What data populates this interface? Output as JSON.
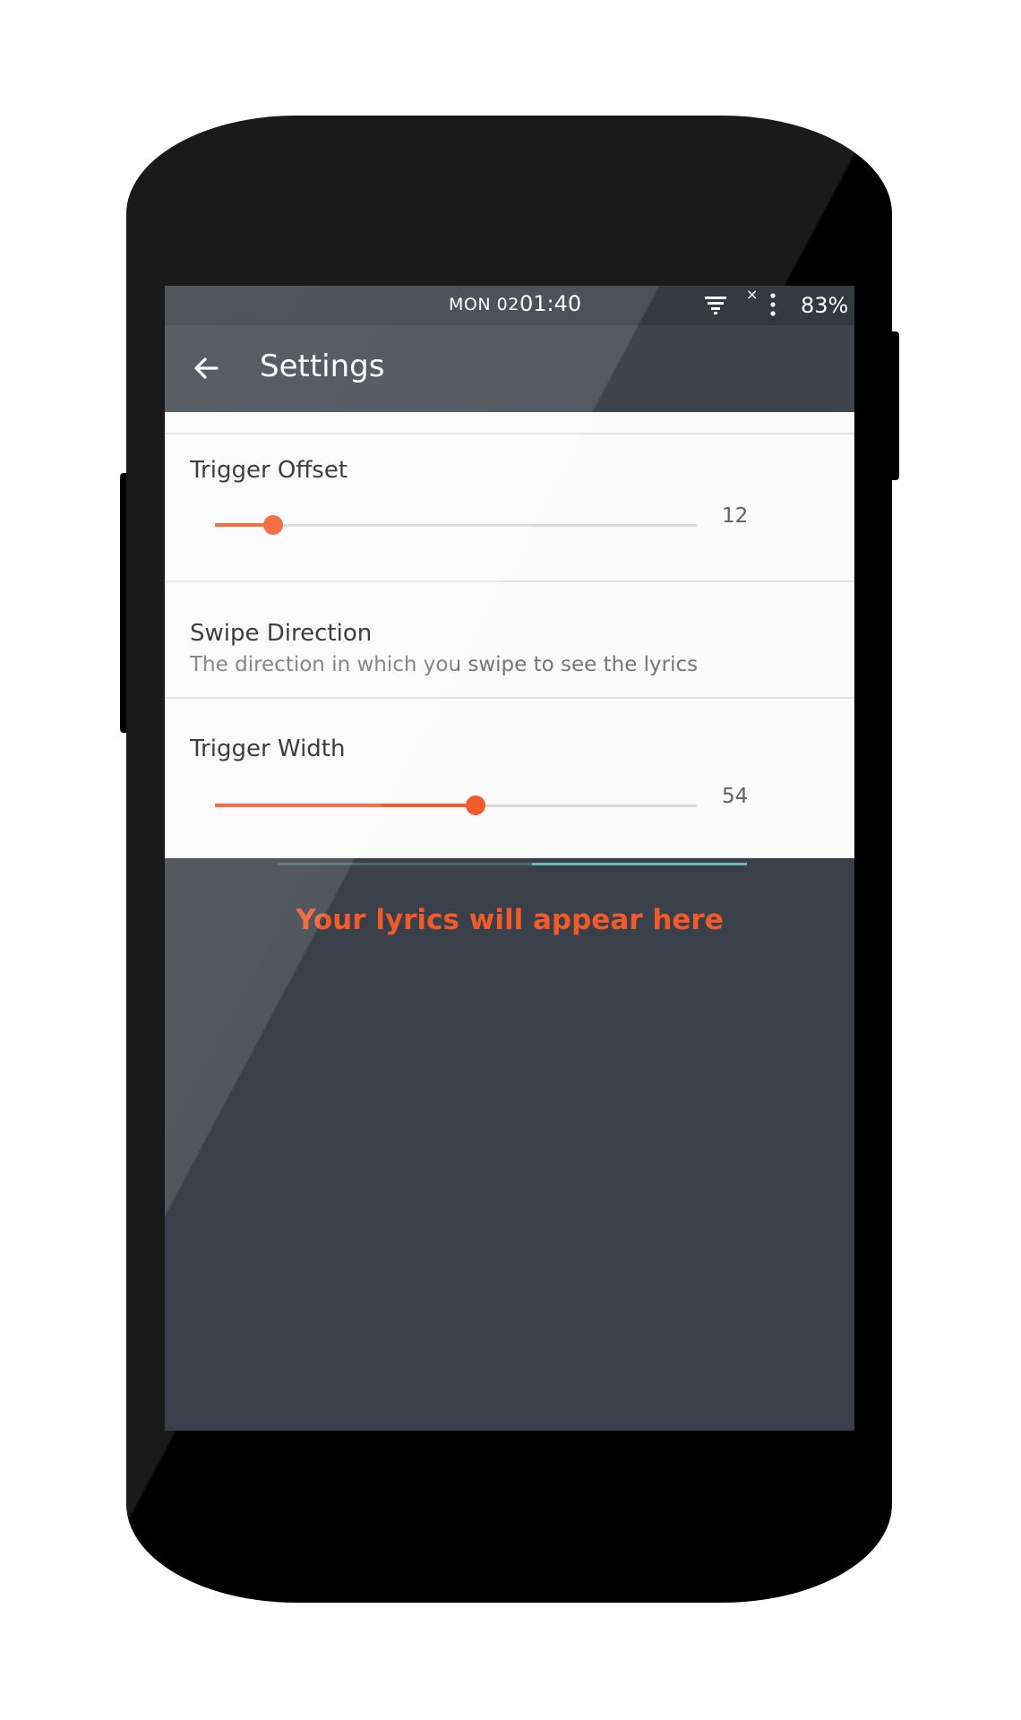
{
  "statusbar": {
    "date": "MON 02",
    "time": "01:40",
    "battery": "83%",
    "notification_close": "×"
  },
  "appbar": {
    "title": "Settings"
  },
  "preferences": {
    "trigger_offset": {
      "title": "Trigger Offset",
      "value": "12",
      "fraction": 0.12
    },
    "swipe_direction": {
      "title": "Swipe Direction",
      "summary": "The direction in which you swipe to see the lyrics"
    },
    "trigger_width": {
      "title": "Trigger Width",
      "value": "54",
      "fraction": 0.54
    }
  },
  "main": {
    "placeholder": "Your lyrics will appear here"
  },
  "colors": {
    "accent": "#f15a2b",
    "appbar": "#3d444c",
    "background": "#394049",
    "tab_indicator": "#6fb9b7"
  },
  "icons": {
    "back": "arrow-back-icon",
    "wifi": "wifi-icon",
    "more": "more-vert-icon"
  }
}
